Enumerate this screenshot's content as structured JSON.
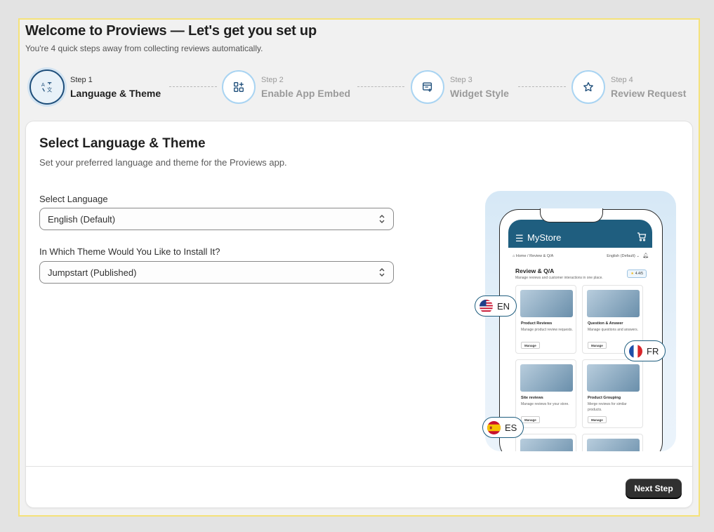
{
  "header": {
    "title": "Welcome to Proviews — Let's get you set up",
    "subtitle": "You're 4 quick steps away from collecting reviews automatically."
  },
  "steps": [
    {
      "num": "Step 1",
      "label": "Language & Theme",
      "active": true,
      "icon": "translate-icon"
    },
    {
      "num": "Step 2",
      "label": "Enable App Embed",
      "active": false,
      "icon": "apps-add-icon"
    },
    {
      "num": "Step 3",
      "label": "Widget Style",
      "active": false,
      "icon": "window-edit-icon"
    },
    {
      "num": "Step 4",
      "label": "Review Request",
      "active": false,
      "icon": "star-icon"
    }
  ],
  "card": {
    "title": "Select Language & Theme",
    "subtitle": "Set your preferred language and theme for the Proviews app.",
    "language": {
      "label": "Select Language",
      "value": "English (Default)"
    },
    "theme": {
      "label": "In Which Theme Would You Like to Install It?",
      "value": "Jumpstart (Published)"
    },
    "next_label": "Next Step"
  },
  "illustration": {
    "store_name": "MyStore",
    "breadcrumb": "Home / Review & Q/A",
    "lang_select": "English (Default) ⌄",
    "section_title": "Review & Q/A",
    "section_sub": "Manage reviews and customer interactions in one place.",
    "rating": "4.4/5",
    "cards": [
      {
        "title": "Product Reviews",
        "desc": "Manage product review requests.",
        "btn": "Manage"
      },
      {
        "title": "Question & Answer",
        "desc": "Manage questions and answers.",
        "btn": "Manage"
      },
      {
        "title": "Site reviews",
        "desc": "Manage reviews for your store.",
        "btn": "Manage"
      },
      {
        "title": "Product Grouping",
        "desc": "Merge reviews for similar products.",
        "btn": "Manage"
      }
    ],
    "pills": {
      "en": "EN",
      "fr": "FR",
      "es": "ES"
    }
  },
  "colors": {
    "accent": "#1f5e7f",
    "active_step": "#1e4e7a",
    "step_border": "#a9d4f2",
    "frame_border": "#f5e27a",
    "button": "#303030"
  }
}
